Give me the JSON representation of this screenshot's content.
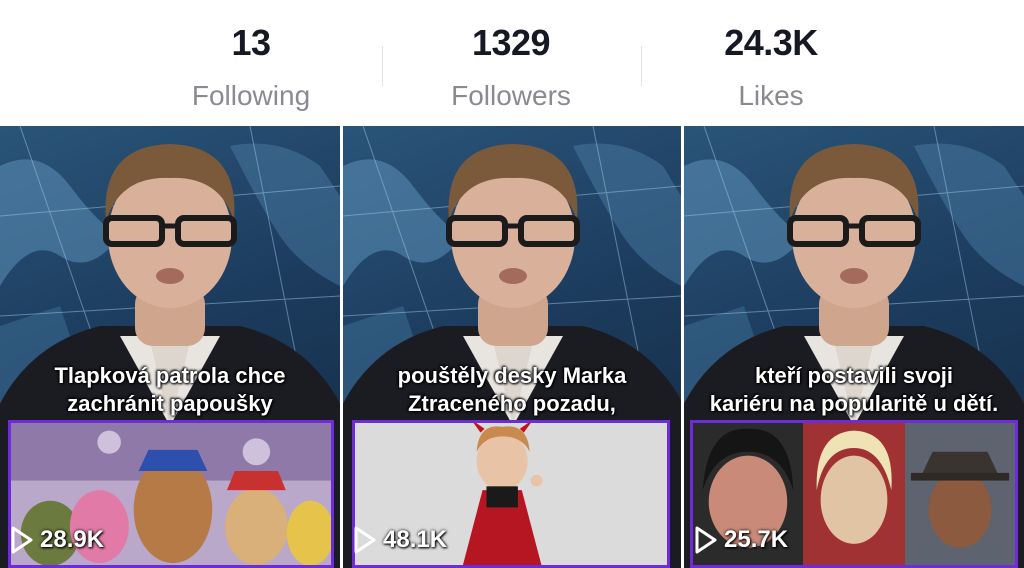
{
  "stats": [
    {
      "value": "13",
      "label": "Following"
    },
    {
      "value": "1329",
      "label": "Followers"
    },
    {
      "value": "24.3K",
      "label": "Likes"
    }
  ],
  "videos": [
    {
      "caption_line1": "Tlapková patrola chce",
      "caption_line2": "zachránit papoušky",
      "views": "28.9K"
    },
    {
      "caption_line1": "pouštěly desky Marka",
      "caption_line2": "Ztraceného pozadu,",
      "views": "48.1K"
    },
    {
      "caption_line1": "kteří postavili svoji",
      "caption_line2": "kariéru na popularitě u dětí.",
      "views": "25.7K"
    }
  ],
  "icons": {
    "play": "play-icon"
  },
  "colors": {
    "accent_border": "#6d2bd9",
    "stat_value": "#161823",
    "stat_label": "#8a8b91"
  }
}
